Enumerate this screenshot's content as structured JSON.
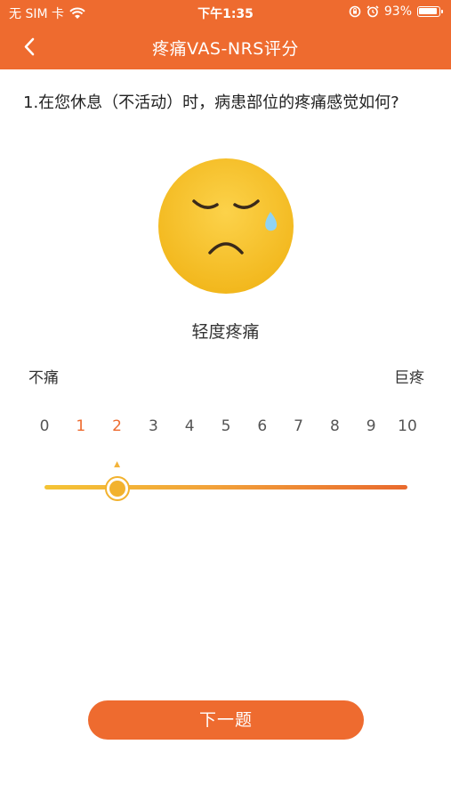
{
  "status_bar": {
    "carrier": "无 SIM 卡",
    "time": "下午1:35",
    "battery_percent": "93%",
    "battery_level": 0.93,
    "icons": [
      "wifi-icon",
      "rotation-lock-icon",
      "alarm-icon",
      "battery-icon"
    ]
  },
  "nav": {
    "title": "疼痛VAS-NRS评分",
    "back_icon": "chevron-left-icon"
  },
  "question": {
    "text": "1.在您休息（不活动）时，病患部位的疼痛感觉如何?"
  },
  "face": {
    "icon": "sad-face-emoji-icon"
  },
  "result": {
    "level_label": "轻度疼痛"
  },
  "scale": {
    "min_label": "不痛",
    "max_label": "巨疼",
    "numbers": [
      "0",
      "1",
      "2",
      "3",
      "4",
      "5",
      "6",
      "7",
      "8",
      "9",
      "10"
    ],
    "active": [
      "1",
      "2"
    ],
    "selected_value": 2,
    "min": 0,
    "max": 10
  },
  "colors": {
    "brand": "#EE6B2F",
    "thumb": "#F2B22E",
    "track_start": "#F4C435",
    "track_end": "#E96A2E"
  },
  "footer": {
    "next_label": "下一题"
  }
}
